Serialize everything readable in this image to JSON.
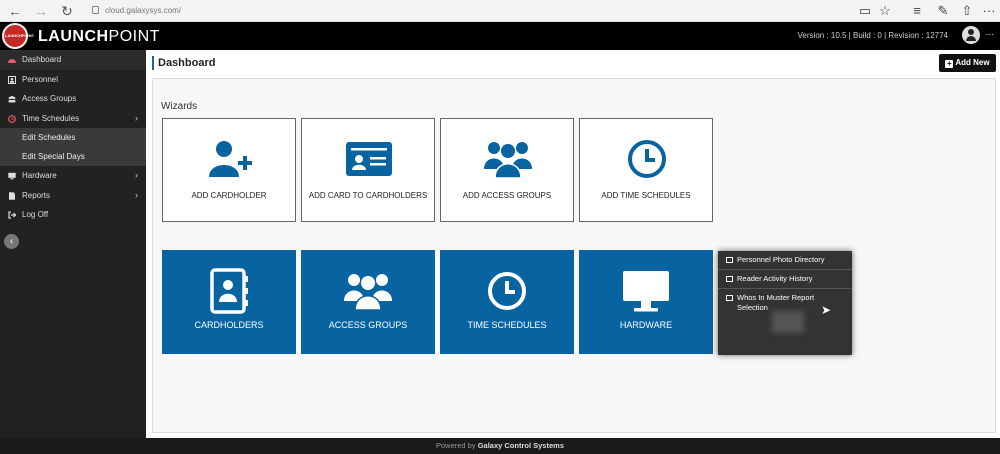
{
  "browser": {
    "url": "cloud.galaxysys.com/",
    "icons": [
      "back-icon",
      "forward-icon",
      "refresh-icon",
      "lock-icon",
      "reading-view-icon",
      "favorite-star-icon",
      "hub-icon",
      "notes-icon",
      "share-icon"
    ]
  },
  "header": {
    "logo_text": "LAUNCHPOINT",
    "brand_bold": "LAUNCH",
    "brand_light": "POINT",
    "version": "Version : 10.5  |  Build : 0  |  Revision : 12774",
    "more": "..."
  },
  "sidebar": {
    "items": [
      {
        "label": "Dashboard",
        "icon": "dashboard-icon"
      },
      {
        "label": "Personnel",
        "icon": "personnel-icon"
      },
      {
        "label": "Access Groups",
        "icon": "group-icon"
      },
      {
        "label": "Time Schedules",
        "icon": "clock-icon"
      },
      {
        "label": "Edit Schedules"
      },
      {
        "label": "Edit Special Days"
      },
      {
        "label": "Hardware",
        "icon": "monitor-icon"
      },
      {
        "label": "Reports",
        "icon": "report-icon"
      },
      {
        "label": "Log Off",
        "icon": "logoff-icon"
      }
    ]
  },
  "main": {
    "title": "Dashboard",
    "add_new": "Add New",
    "wizards_title": "Wizards",
    "wizards": [
      {
        "label": "ADD CARDHOLDER",
        "icon": "add-user-icon"
      },
      {
        "label": "ADD CARD TO CARDHOLDERS",
        "icon": "id-card-icon"
      },
      {
        "label": "ADD ACCESS GROUPS",
        "icon": "group-icon"
      },
      {
        "label": "ADD TIME SCHEDULES",
        "icon": "clock-icon"
      }
    ],
    "tiles": [
      {
        "label": "CARDHOLDERS",
        "icon": "address-book-icon"
      },
      {
        "label": "ACCESS GROUPS",
        "icon": "group-icon"
      },
      {
        "label": "TIME SCHEDULES",
        "icon": "clock-icon"
      },
      {
        "label": "HARDWARE",
        "icon": "monitor-icon"
      }
    ],
    "report_menu": [
      "Personnel Photo Directory",
      "Reader Activity History",
      "Whos In Muster Report Selection"
    ]
  },
  "footer": {
    "prefix": "Powered by",
    "company": "Galaxy Control Systems"
  },
  "colors": {
    "tile_blue": "#0863a1",
    "sidebar_bg": "#222222",
    "brand_red": "#c62828"
  }
}
